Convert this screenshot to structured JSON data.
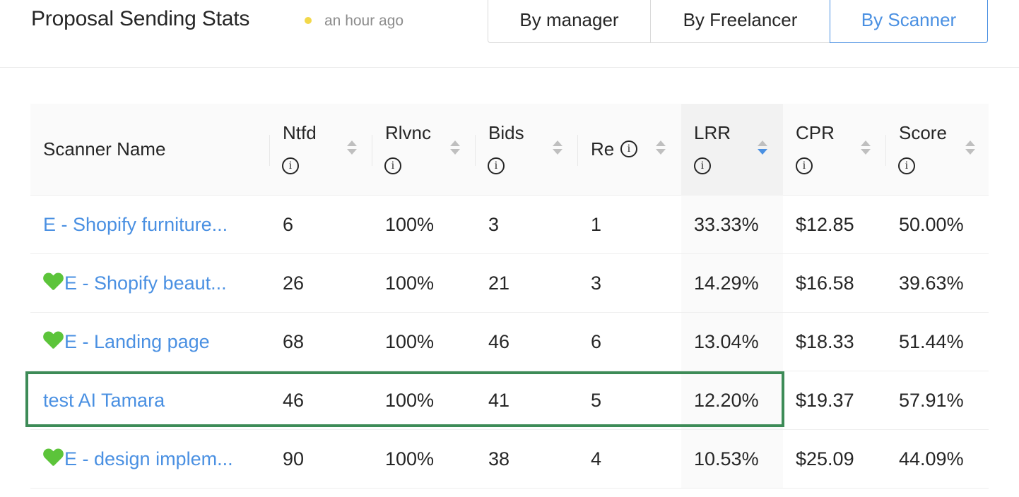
{
  "header": {
    "title": "Proposal Sending Stats",
    "status_color": "#f2d84a",
    "updated": "an hour ago",
    "view_options": [
      {
        "label": "By manager",
        "selected": false
      },
      {
        "label": "By Freelancer",
        "selected": false
      },
      {
        "label": "By Scanner",
        "selected": true
      }
    ]
  },
  "table": {
    "columns": [
      {
        "key": "name",
        "label": "Scanner Name",
        "info": false,
        "sortable": false
      },
      {
        "key": "ntfd",
        "label": "Ntfd",
        "info": true,
        "sortable": true
      },
      {
        "key": "rlvnc",
        "label": "Rlvnc",
        "info": true,
        "sortable": true
      },
      {
        "key": "bids",
        "label": "Bids",
        "info": true,
        "sortable": true
      },
      {
        "key": "re",
        "label": "Re",
        "info": true,
        "sortable": true
      },
      {
        "key": "lrr",
        "label": "LRR",
        "info": true,
        "sortable": true,
        "sort": "descending"
      },
      {
        "key": "cpr",
        "label": "CPR",
        "info": true,
        "sortable": true
      },
      {
        "key": "score",
        "label": "Score",
        "info": true,
        "sortable": true
      }
    ],
    "info_glyph": "i",
    "rows": [
      {
        "heart": false,
        "name": "E - Shopify furniture...",
        "ntfd": "6",
        "rlvnc": "100%",
        "bids": "3",
        "re": "1",
        "lrr": "33.33%",
        "cpr": "$12.85",
        "score": "50.00%",
        "highlighted": false
      },
      {
        "heart": true,
        "name": "E - Shopify beaut...",
        "ntfd": "26",
        "rlvnc": "100%",
        "bids": "21",
        "re": "3",
        "lrr": "14.29%",
        "cpr": "$16.58",
        "score": "39.63%",
        "highlighted": false
      },
      {
        "heart": true,
        "name": "E - Landing page",
        "ntfd": "68",
        "rlvnc": "100%",
        "bids": "46",
        "re": "6",
        "lrr": "13.04%",
        "cpr": "$18.33",
        "score": "51.44%",
        "highlighted": false
      },
      {
        "heart": false,
        "name": "test AI Tamara",
        "ntfd": "46",
        "rlvnc": "100%",
        "bids": "41",
        "re": "5",
        "lrr": "12.20%",
        "cpr": "$19.37",
        "score": "57.91%",
        "highlighted": true
      },
      {
        "heart": true,
        "name": "E - design implem...",
        "ntfd": "90",
        "rlvnc": "100%",
        "bids": "38",
        "re": "4",
        "lrr": "10.53%",
        "cpr": "$25.09",
        "score": "44.09%",
        "highlighted": false
      }
    ]
  },
  "colors": {
    "accent": "#4a90e2",
    "highlight_border": "#3d8b57",
    "heart": "#5cc43a"
  }
}
